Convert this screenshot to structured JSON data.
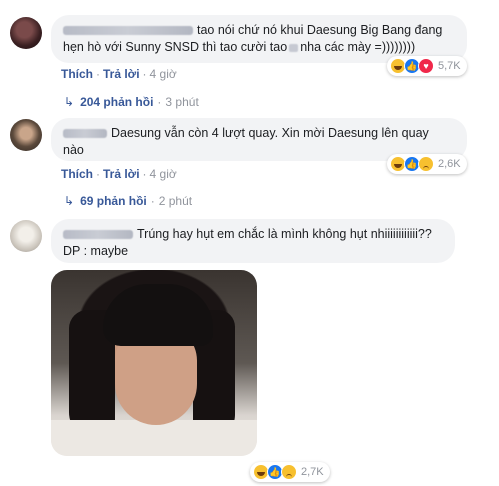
{
  "comments": [
    {
      "text_line1": "tao nói chứ nó khui Daesung Big Bang đang",
      "text_line2a": "hẹn hò với Sunny SNSD thì tao cười tao",
      "text_line2b": "nha các mày =))))))))",
      "actions": {
        "like": "Thích",
        "reply": "Trả lời",
        "time": "4 giờ"
      },
      "reactions": {
        "count": "5,7K",
        "types": [
          "haha",
          "like",
          "love"
        ]
      },
      "replies": {
        "label": "204 phản hồi",
        "time": "3 phút"
      }
    },
    {
      "text_line1": "Daesung vẫn còn 4 lượt quay. Xin mời Daesung lên quay",
      "text_line2": "nào",
      "actions": {
        "like": "Thích",
        "reply": "Trả lời",
        "time": "4 giờ"
      },
      "reactions": {
        "count": "2,6K",
        "types": [
          "haha",
          "like",
          "sad"
        ]
      },
      "replies": {
        "label": "69 phản hồi",
        "time": "2 phút"
      }
    },
    {
      "text_line1": "Trúng hay hụt em chắc là mình không hụt nhiiiiiiiiiiii??",
      "text_line2": "DP : maybe",
      "reactions": {
        "count": "2,7K",
        "types": [
          "haha",
          "like",
          "sad"
        ]
      }
    }
  ],
  "colors": {
    "link": "#385898",
    "bubble": "#f2f3f5",
    "meta": "#90949c"
  }
}
